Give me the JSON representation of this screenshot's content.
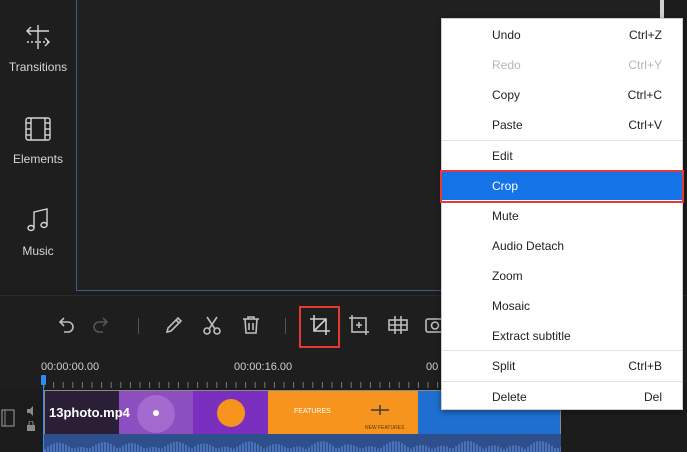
{
  "sidebar": {
    "items": [
      {
        "label": "Transitions",
        "icon": "transitions-icon"
      },
      {
        "label": "Elements",
        "icon": "elements-icon"
      },
      {
        "label": "Music",
        "icon": "music-icon"
      }
    ]
  },
  "toolbar": {
    "tools": [
      "undo-icon",
      "redo-icon",
      "pencil-icon",
      "scissors-icon",
      "trash-icon",
      "crop-icon",
      "freeze-frame-icon",
      "mosaic-grid-icon",
      "record-icon"
    ]
  },
  "timeline": {
    "times": [
      "00:00:00.00",
      "00:00:16.00",
      "00"
    ],
    "clip_name": "13photo.mp4",
    "clip_texts": {
      "features": "FEATURES",
      "small": "NEW FEATURES"
    }
  },
  "context_menu": {
    "items": [
      {
        "label": "Undo",
        "shortcut": "Ctrl+Z",
        "disabled": false
      },
      {
        "label": "Redo",
        "shortcut": "Ctrl+Y",
        "disabled": true
      },
      {
        "label": "Copy",
        "shortcut": "Ctrl+C",
        "disabled": false
      },
      {
        "label": "Paste",
        "shortcut": "Ctrl+V",
        "disabled": false
      },
      {
        "label": "Edit",
        "shortcut": "",
        "disabled": false
      },
      {
        "label": "Crop",
        "shortcut": "",
        "disabled": false,
        "selected": true
      },
      {
        "label": "Mute",
        "shortcut": "",
        "disabled": false
      },
      {
        "label": "Audio Detach",
        "shortcut": "",
        "disabled": false
      },
      {
        "label": "Zoom",
        "shortcut": "",
        "disabled": false
      },
      {
        "label": "Mosaic",
        "shortcut": "",
        "disabled": false
      },
      {
        "label": "Extract subtitle",
        "shortcut": "",
        "disabled": false
      },
      {
        "label": "Split",
        "shortcut": "Ctrl+B",
        "disabled": false
      },
      {
        "label": "Delete",
        "shortcut": "Del",
        "disabled": false
      }
    ]
  },
  "colors": {
    "accent": "#1473e6",
    "highlight": "#e53935",
    "clip_purple": "#7b2fbf",
    "clip_orange": "#f7941d",
    "clip_blue": "#1f6fd1"
  }
}
